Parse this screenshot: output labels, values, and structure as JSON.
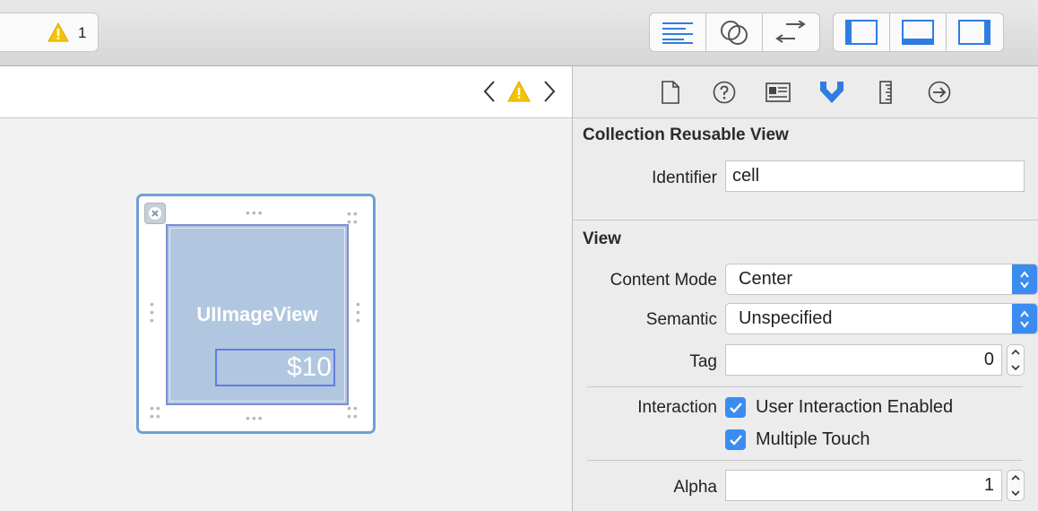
{
  "toolbar": {
    "warning_count": "1",
    "editor_buttons": [
      "standard-editor",
      "assistant-editor",
      "version-editor"
    ],
    "view_buttons": [
      "navigator-panel",
      "debug-panel",
      "utilities-panel"
    ]
  },
  "canvas": {
    "image_view_label": "UIImageView",
    "price_label": "$10"
  },
  "inspector": {
    "tabs": [
      "file-inspector",
      "quick-help",
      "identity-inspector",
      "attributes-inspector",
      "size-inspector",
      "connections-inspector"
    ],
    "reusable_view": {
      "title": "Collection Reusable View",
      "identifier_label": "Identifier",
      "identifier_value": "cell"
    },
    "view": {
      "title": "View",
      "content_mode_label": "Content Mode",
      "content_mode_value": "Center",
      "semantic_label": "Semantic",
      "semantic_value": "Unspecified",
      "tag_label": "Tag",
      "tag_value": "0",
      "interaction_label": "Interaction",
      "user_interaction_label": "User Interaction Enabled",
      "multiple_touch_label": "Multiple Touch",
      "alpha_label": "Alpha",
      "alpha_value": "1"
    }
  },
  "colors": {
    "accent": "#3b8cf0",
    "warning": "#f5c400",
    "selection": "#6ea0d8"
  }
}
